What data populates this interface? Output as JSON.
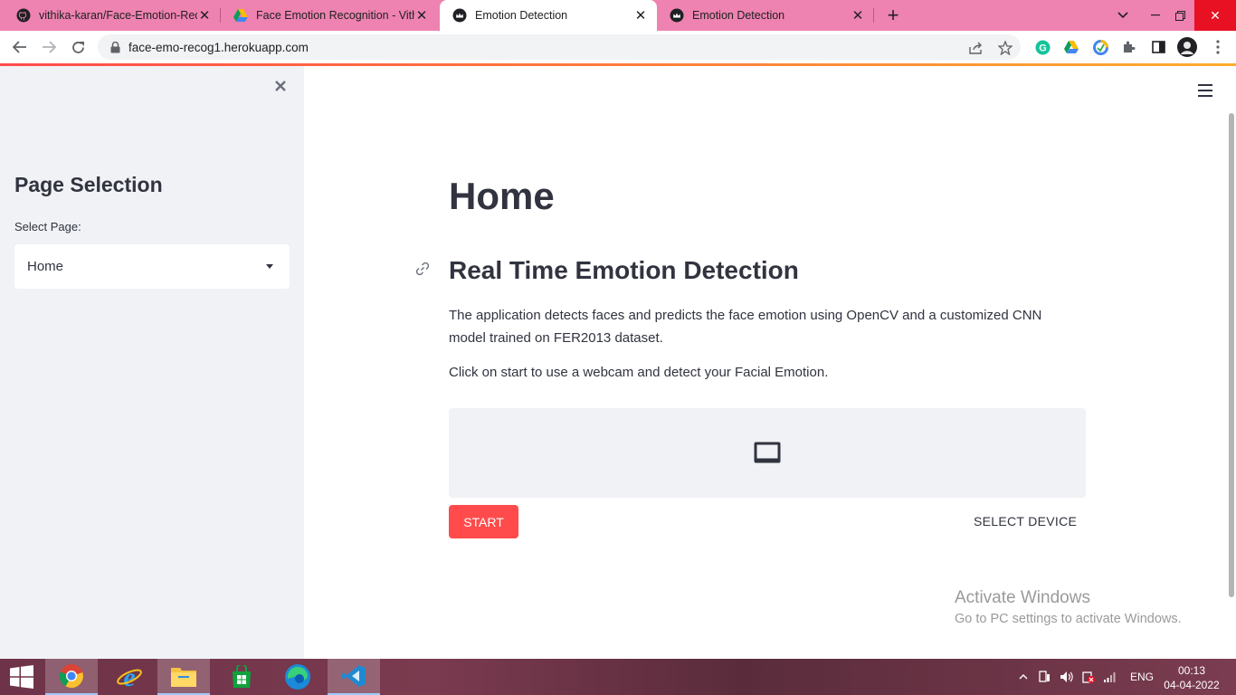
{
  "browser": {
    "tabs": [
      {
        "title": "vithika-karan/Face-Emotion-Recognition",
        "favicon": "github-icon",
        "active": false
      },
      {
        "title": "Face Emotion Recognition - Vithika",
        "favicon": "google-drive-icon",
        "active": false
      },
      {
        "title": "Emotion Detection",
        "favicon": "streamlit-crown-icon",
        "active": true
      },
      {
        "title": "Emotion Detection",
        "favicon": "streamlit-crown-icon",
        "active": false
      }
    ],
    "url": "face-emo-recog1.herokuapp.com",
    "accent_gradient": [
      "#ff4b4b",
      "#fdac2e"
    ],
    "tabstrip_color": "#ee82b0"
  },
  "sidebar": {
    "heading": "Page Selection",
    "select_label": "Select Page:",
    "select_value": "Home"
  },
  "main": {
    "title": "Home",
    "subtitle": "Real Time Emotion Detection",
    "description": "The application detects faces and predicts the face emotion using OpenCV and a customized CNN model trained on FER2013 dataset.",
    "instruction": "Click on start to use a webcam and detect your Facial Emotion.",
    "start_label": "START",
    "select_device_label": "SELECT DEVICE",
    "primary_color": "#ff4b4b"
  },
  "watermark": {
    "line1": "Activate Windows",
    "line2": "Go to PC settings to activate Windows."
  },
  "taskbar": {
    "language": "ENG",
    "time": "00:13",
    "date": "04-04-2022"
  }
}
